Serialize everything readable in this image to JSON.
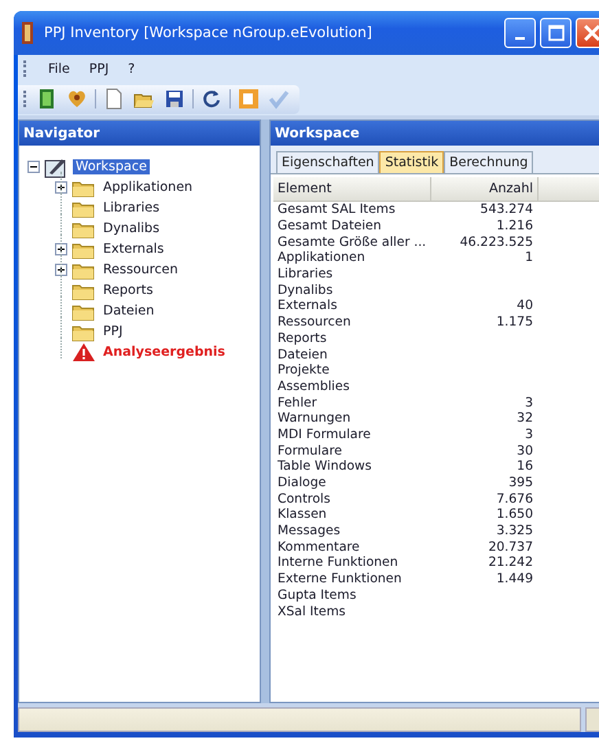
{
  "window": {
    "title": "PPJ Inventory [Workspace nGroup.eEvolution]"
  },
  "menu": [
    "File",
    "PPJ",
    "?"
  ],
  "toolbar": [
    {
      "kind": "exit",
      "disabled": false
    },
    {
      "kind": "help",
      "disabled": false
    },
    {
      "kind": "sep"
    },
    {
      "kind": "new",
      "disabled": false
    },
    {
      "kind": "open",
      "disabled": false
    },
    {
      "kind": "save",
      "disabled": false
    },
    {
      "kind": "sep"
    },
    {
      "kind": "refresh",
      "disabled": false
    },
    {
      "kind": "sep"
    },
    {
      "kind": "export",
      "disabled": false
    },
    {
      "kind": "check",
      "disabled": true
    }
  ],
  "navigator": {
    "title": "Navigator",
    "tree": [
      {
        "label": "Workspace",
        "kind": "workspace",
        "selected": true,
        "expanded": true,
        "children": [
          {
            "label": "Applikationen",
            "kind": "folder",
            "selected": false,
            "has_children": true
          },
          {
            "label": "Libraries",
            "kind": "folder",
            "selected": false,
            "has_children": false
          },
          {
            "label": "Dynalibs",
            "kind": "folder",
            "selected": false,
            "has_children": false
          },
          {
            "label": "Externals",
            "kind": "folder",
            "selected": false,
            "has_children": true
          },
          {
            "label": "Ressourcen",
            "kind": "folder",
            "selected": false,
            "has_children": true
          },
          {
            "label": "Reports",
            "kind": "folder",
            "selected": false,
            "has_children": false
          },
          {
            "label": "Dateien",
            "kind": "folder",
            "selected": false,
            "has_children": false
          },
          {
            "label": "PPJ",
            "kind": "folder",
            "selected": false,
            "has_children": false
          },
          {
            "label": "Analyseergebnis",
            "kind": "warning",
            "selected": false,
            "has_children": false
          }
        ]
      }
    ]
  },
  "workspace": {
    "title": "Workspace",
    "tabs": [
      {
        "label": "Eigenschaften",
        "selected": false
      },
      {
        "label": "Statistik",
        "selected": true
      },
      {
        "label": "Berechnung",
        "selected": false
      }
    ],
    "table": {
      "columns": [
        "Element",
        "Anzahl"
      ],
      "rows": [
        [
          "Gesamt SAL Items",
          "543.274"
        ],
        [
          "Gesamt Dateien",
          "1.216"
        ],
        [
          "Gesamte Größe aller ...",
          "46.223.525"
        ],
        [
          "Applikationen",
          "1"
        ],
        [
          "Libraries",
          ""
        ],
        [
          "Dynalibs",
          ""
        ],
        [
          "Externals",
          "40"
        ],
        [
          "Ressourcen",
          "1.175"
        ],
        [
          "Reports",
          ""
        ],
        [
          "Dateien",
          ""
        ],
        [
          "Projekte",
          ""
        ],
        [
          "Assemblies",
          ""
        ],
        [
          "Fehler",
          "3"
        ],
        [
          "Warnungen",
          "32"
        ],
        [
          "MDI Formulare",
          "3"
        ],
        [
          "Formulare",
          "30"
        ],
        [
          "Table Windows",
          "16"
        ],
        [
          "Dialoge",
          "395"
        ],
        [
          "Controls",
          "7.676"
        ],
        [
          "Klassen",
          "1.650"
        ],
        [
          "Messages",
          "3.325"
        ],
        [
          "Kommentare",
          "20.737"
        ],
        [
          "Interne Funktionen",
          "21.242"
        ],
        [
          "Externe Funktionen",
          "1.449"
        ],
        [
          "Gupta Items",
          ""
        ],
        [
          "XSal Items",
          ""
        ]
      ]
    }
  }
}
